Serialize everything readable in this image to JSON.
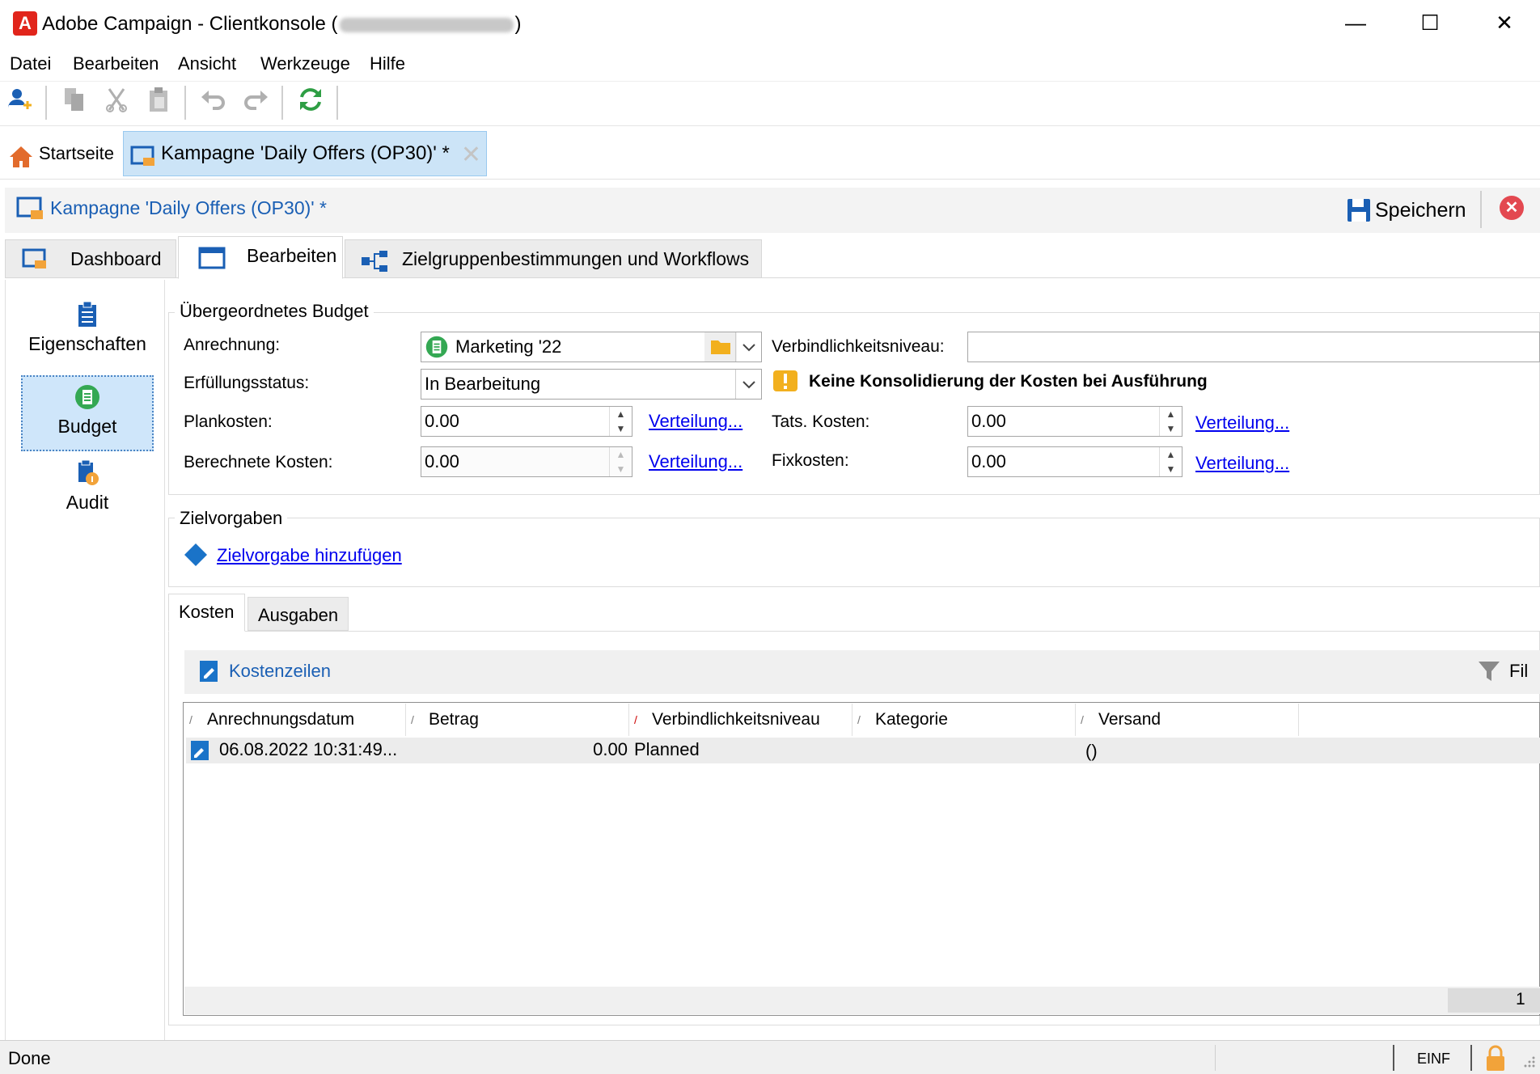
{
  "window": {
    "title_prefix": "Adobe Campaign - Clientkonsole (",
    "title_suffix": ")",
    "logo_letter": "A",
    "minimize": "—",
    "maximize": "☐",
    "close": "✕"
  },
  "menu": [
    "Datei",
    "Bearbeiten",
    "Ansicht",
    "Werkzeuge",
    "Hilfe"
  ],
  "doc_tabs": {
    "home": "Startseite",
    "campaign": "Kampagne 'Daily Offers (OP30)' *",
    "close": "✕"
  },
  "editor": {
    "title": "Kampagne 'Daily Offers (OP30)' *",
    "save": "Speichern",
    "close_icon": "✕"
  },
  "view_tabs": [
    "Dashboard",
    "Bearbeiten",
    "Zielgruppenbestimmungen und Workflows"
  ],
  "left_nav": [
    "Eigenschaften",
    "Budget",
    "Audit"
  ],
  "budget": {
    "group_label": "Übergeordnetes Budget",
    "anrechnung_label": "Anrechnung:",
    "anrechnung_value": "Marketing '22",
    "verbindlichkeit_label": "Verbindlichkeitsniveau:",
    "verbindlichkeit_value": "",
    "status_label": "Erfüllungsstatus:",
    "status_value": "In Bearbeitung",
    "warning": "Keine Konsolidierung der Kosten bei Ausführung",
    "plankosten_label": "Plankosten:",
    "plankosten_value": "0.00",
    "tats_label": "Tats. Kosten:",
    "tats_value": "0.00",
    "berechnet_label": "Berechnete Kosten:",
    "berechnet_value": "0.00",
    "fix_label": "Fixkosten:",
    "fix_value": "0.00",
    "verteilung": "Verteilung..."
  },
  "targets": {
    "group_label": "Zielvorgaben",
    "add_link": "Zielvorgabe hinzufügen"
  },
  "cost_tabs": [
    "Kosten",
    "Ausgaben"
  ],
  "cost_grid": {
    "toolbar_label": "Kostenzeilen",
    "filter_label": "Fil",
    "columns": [
      "Anrechnungsdatum",
      "Betrag",
      "Verbindlichkeitsniveau",
      "Kategorie",
      "Versand"
    ],
    "rows": [
      {
        "date": "06.08.2022 10:31:49...",
        "amount": "0.00",
        "level": "Planned",
        "category": "",
        "delivery": "()"
      }
    ],
    "footer_count": "1"
  },
  "status_bar": {
    "text": "Done",
    "mode": "EINF"
  },
  "colors": {
    "accent_blue": "#1a5fb4",
    "tab_selected": "#cce4f7",
    "brand_red": "#e1251b",
    "warning_yellow": "#f2b01e",
    "budget_green": "#34a853"
  }
}
